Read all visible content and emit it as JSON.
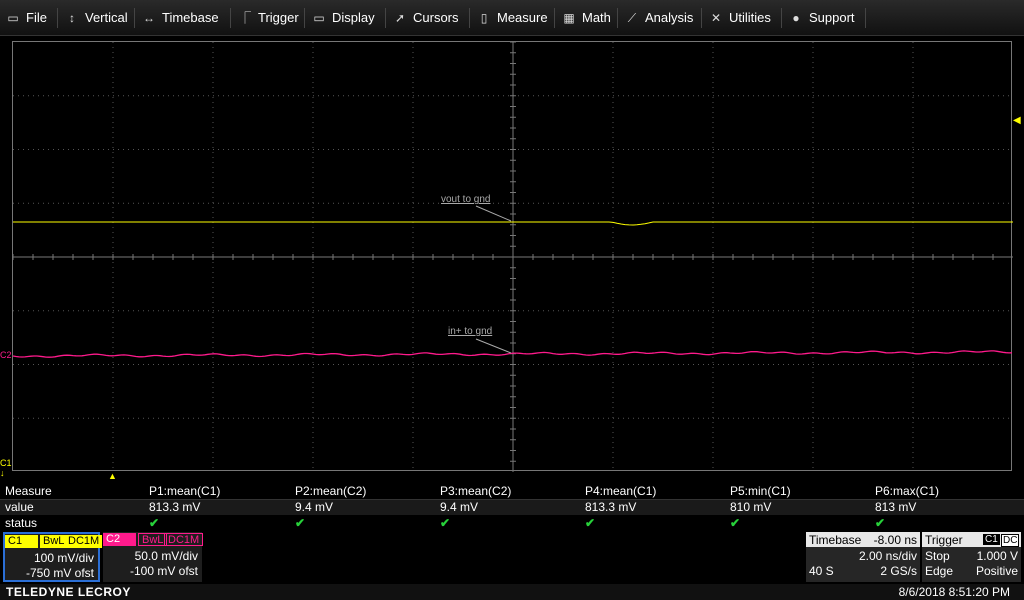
{
  "menu": [
    {
      "label": "File",
      "icon": "file-icon"
    },
    {
      "label": "Vertical",
      "icon": "vertical-icon"
    },
    {
      "label": "Timebase",
      "icon": "timebase-icon"
    },
    {
      "label": "Trigger",
      "icon": "trigger-icon"
    },
    {
      "label": "Display",
      "icon": "display-icon"
    },
    {
      "label": "Cursors",
      "icon": "cursors-icon"
    },
    {
      "label": "Measure",
      "icon": "measure-icon"
    },
    {
      "label": "Math",
      "icon": "math-icon"
    },
    {
      "label": "Analysis",
      "icon": "analysis-icon"
    },
    {
      "label": "Utilities",
      "icon": "utilities-icon"
    },
    {
      "label": "Support",
      "icon": "support-icon"
    }
  ],
  "traces": {
    "c1_label": "vout to gnd",
    "c2_label": "in+ to gnd",
    "c1_color": "#ffff00",
    "c2_color": "#ff1a8c"
  },
  "markers": {
    "c1": "C1",
    "c2": "C2"
  },
  "measure": {
    "row_labels": [
      "Measure",
      "value",
      "status"
    ],
    "params": [
      {
        "name": "P1:mean(C1)",
        "value": "813.3 mV"
      },
      {
        "name": "P2:mean(C2)",
        "value": "9.4 mV"
      },
      {
        "name": "P3:mean(C2)",
        "value": "9.4 mV"
      },
      {
        "name": "P4:mean(C1)",
        "value": "813.3 mV"
      },
      {
        "name": "P5:min(C1)",
        "value": "810 mV"
      },
      {
        "name": "P6:max(C1)",
        "value": "813 mV"
      }
    ],
    "status_mark": "✔"
  },
  "channels": [
    {
      "name": "C1",
      "bw": "BwL",
      "coupling": "DC1M",
      "vdiv": "100 mV/div",
      "offset": "-750 mV ofst",
      "color": "#ffff00"
    },
    {
      "name": "C2",
      "bw": "BwL",
      "coupling": "DC1M",
      "vdiv": "50.0 mV/div",
      "offset": "-100 mV ofst",
      "color": "#ff1a8c"
    }
  ],
  "timebase": {
    "title": "Timebase",
    "delay": "-8.00 ns",
    "tdiv": "2.00 ns/div",
    "samples": "40 S",
    "rate": "2 GS/s"
  },
  "trigger": {
    "title": "Trigger",
    "src": "C1",
    "coupling": "DC",
    "mode": "Stop",
    "level": "1.000 V",
    "type": "Edge",
    "slope": "Positive"
  },
  "footer": {
    "brand": "TELEDYNE LECROY",
    "datetime": "8/6/2018 8:51:20 PM"
  }
}
